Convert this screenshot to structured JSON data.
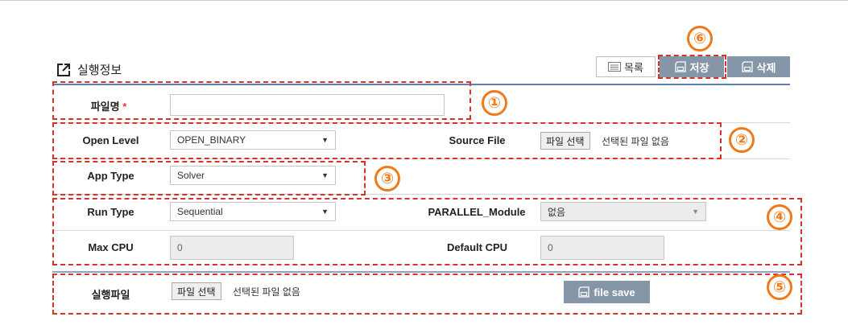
{
  "header": {
    "title": "실행정보",
    "buttons": {
      "list": "목록",
      "save": "저장",
      "delete": "삭제"
    }
  },
  "form": {
    "file_name": {
      "label": "파일명",
      "required_mark": "*",
      "value": ""
    },
    "open_level": {
      "label": "Open Level",
      "value": "OPEN_BINARY"
    },
    "source_file": {
      "label": "Source File",
      "button": "파일 선택",
      "status": "선택된 파일 없음"
    },
    "app_type": {
      "label": "App Type",
      "value": "Solver"
    },
    "run_type": {
      "label": "Run Type",
      "value": "Sequential"
    },
    "parallel_module": {
      "label": "PARALLEL_Module",
      "value": "없음"
    },
    "max_cpu": {
      "label": "Max CPU",
      "value": "0"
    },
    "default_cpu": {
      "label": "Default CPU",
      "value": "0"
    },
    "exec_file": {
      "label": "실행파일",
      "button": "파일 선택",
      "status": "선택된 파일 없음",
      "save_button": "file save"
    }
  },
  "annotations": [
    "①",
    "②",
    "③",
    "④",
    "⑤",
    "⑥"
  ],
  "colors": {
    "annotation_circle": "#f07a1a",
    "annotation_box": "#d8332a",
    "button_gray": "#8596a8",
    "header_rule": "#5f7fb4"
  }
}
